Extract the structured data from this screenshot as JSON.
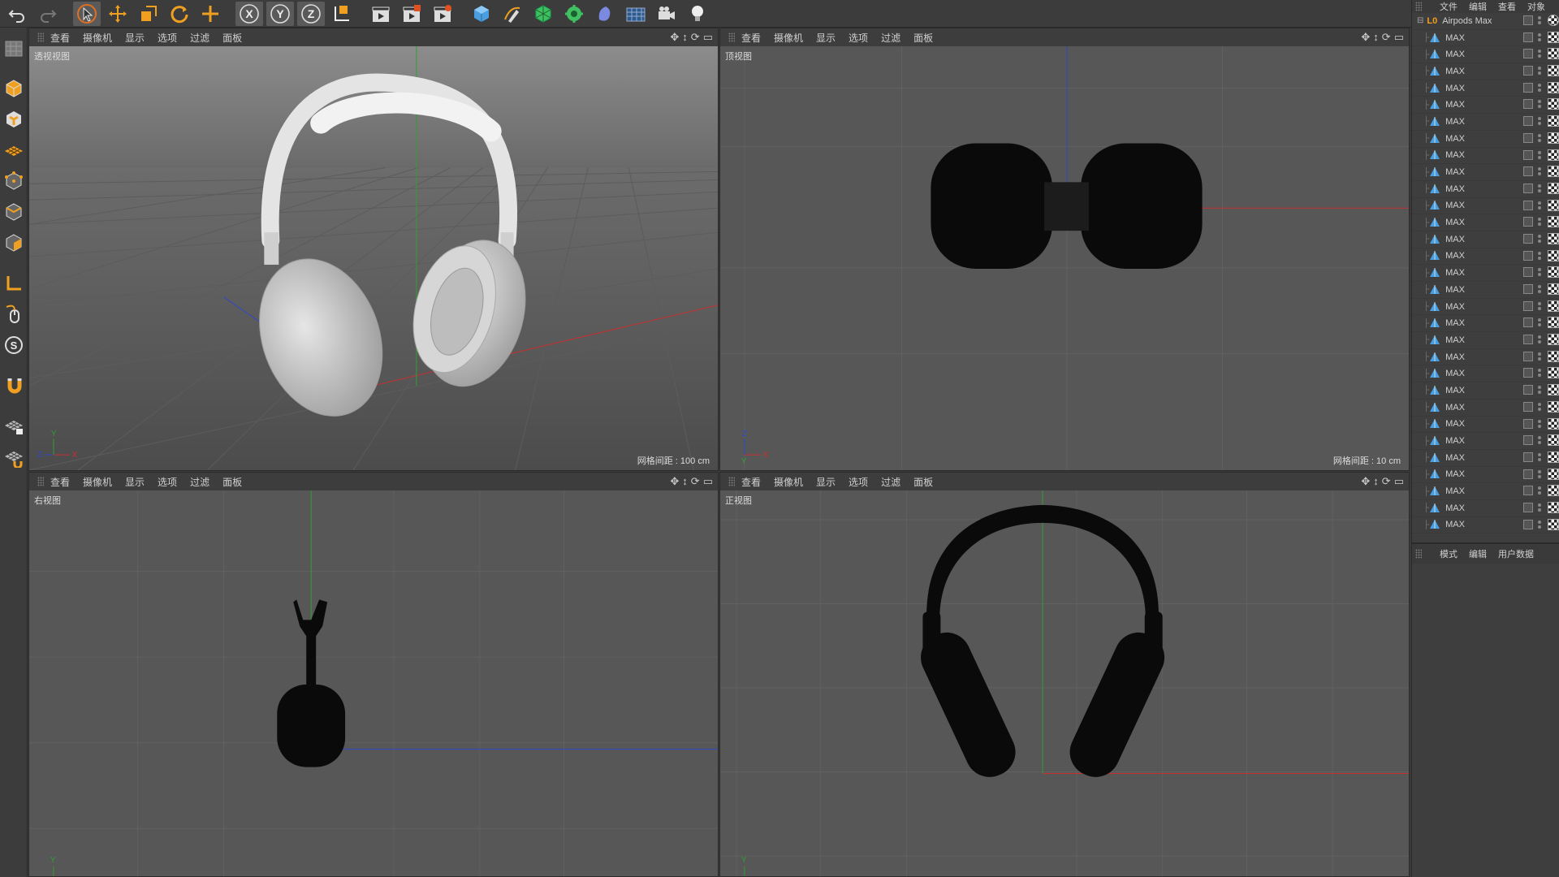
{
  "toolbar": {
    "buttons": [
      "undo-icon",
      "redo-icon",
      "select-arrow-icon",
      "move-icon",
      "scale-icon",
      "rotate-icon",
      "add-icon",
      "x-axis-lock-icon",
      "y-axis-lock-icon",
      "z-axis-lock-icon",
      "coordinate-system-icon",
      "render-view-icon",
      "render-picture-viewer-icon",
      "render-settings-icon",
      "cube-icon",
      "pen-spline-icon",
      "subdivision-icon",
      "cloner-icon",
      "deformer-icon",
      "floor-icon",
      "camera-icon",
      "light-icon"
    ],
    "axis_labels": [
      "X",
      "Y",
      "Z"
    ]
  },
  "left_toolbar": {
    "buttons": [
      "polygon-pen-icon",
      "model-mode-icon",
      "texture-mode-icon",
      "workplane-icon",
      "points-mode-icon",
      "edges-mode-icon",
      "polygons-mode-icon",
      "axis-mode-icon",
      "tweak-mode-icon",
      "solo-icon",
      "snap-icon",
      "workplane-lock-icon",
      "quantize-icon"
    ],
    "solo_label": "S"
  },
  "viewport_menu": [
    "查看",
    "摄像机",
    "显示",
    "选项",
    "过滤",
    "面板"
  ],
  "viewport_nav": [
    "✥",
    "↕",
    "⟳",
    "▭"
  ],
  "viewports": [
    {
      "id": "perspective",
      "label": "透视视图",
      "grid_spacing": "网格间距 : 100 cm",
      "axis_x": "X",
      "axis_y": "Y",
      "axis_z": "Z"
    },
    {
      "id": "top",
      "label": "顶视图",
      "grid_spacing": "网格间距 : 10 cm",
      "axis_x": "X",
      "axis_y": "Y",
      "axis_z": "Z"
    },
    {
      "id": "right",
      "label": "右视图",
      "grid_spacing": "",
      "axis_y": "Y"
    },
    {
      "id": "front",
      "label": "正视图",
      "grid_spacing": "",
      "axis_y": "Y"
    }
  ],
  "object_manager": {
    "menu": [
      "文件",
      "编辑",
      "查看",
      "对象"
    ],
    "root": {
      "name": "Airpods Max",
      "layer_icon": "L0"
    },
    "children": [
      "MAX",
      "MAX",
      "MAX",
      "MAX",
      "MAX",
      "MAX",
      "MAX",
      "MAX",
      "MAX",
      "MAX",
      "MAX",
      "MAX",
      "MAX",
      "MAX",
      "MAX",
      "MAX",
      "MAX",
      "MAX",
      "MAX",
      "MAX",
      "MAX",
      "MAX",
      "MAX",
      "MAX",
      "MAX",
      "MAX",
      "MAX",
      "MAX",
      "MAX",
      "MAX"
    ]
  },
  "attribute_manager": {
    "menu": [
      "模式",
      "编辑",
      "用户数据"
    ]
  },
  "colors": {
    "accent_orange": "#f0a020",
    "axis_red": "#c83030",
    "axis_green": "#30a030",
    "axis_blue": "#3048c8",
    "viewport_bg": "#575757",
    "panel_bg": "#3e3e3e"
  }
}
